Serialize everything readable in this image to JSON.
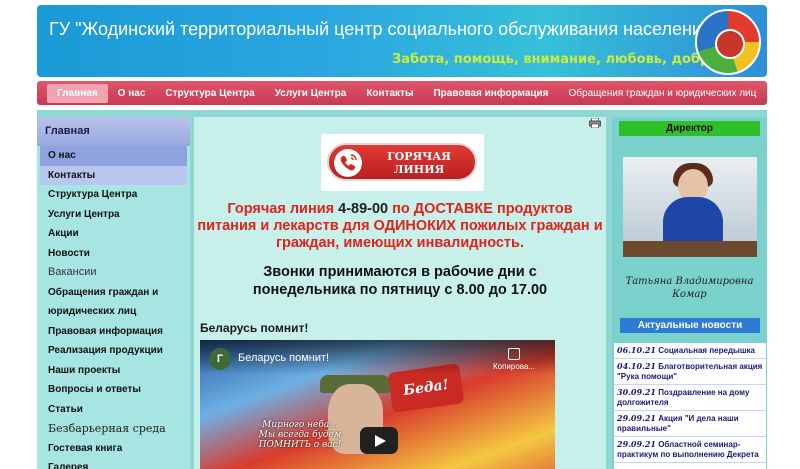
{
  "header": {
    "title": "ГУ \"Жодинский территориальный центр социального обслуживания населения\"",
    "slogan": "Забота, помощь, внимание, любовь, добро"
  },
  "topnav": {
    "items": [
      "Главная",
      "О нас",
      "Структура Центра",
      "Услуги Центра",
      "Контакты",
      "Правовая информация",
      "Обращения граждан и юридических лиц"
    ]
  },
  "sidebar": {
    "heading": "Главная",
    "items": [
      "О нас",
      "Контакты",
      "Структура Центра",
      "Услуги Центра",
      "Акции",
      "Новости",
      "Вакансии",
      "Обращения граждан и",
      "юридических лиц",
      "Правовая информация",
      "Реализация продукции",
      "Наши проекты",
      "Вопросы и ответы",
      "Статьи",
      "Безбарьерная среда",
      "Гостевая книга",
      "Галерея"
    ]
  },
  "center": {
    "hotline_banner": "ГОРЯЧАЯ ЛИНИЯ",
    "hotline_label": "Горячая линия",
    "hotline_number": "4-89-00",
    "hotline_rest": "по ДОСТАВКЕ продуктов питания и лекарств для ОДИНОКИХ пожилых граждан и граждан, имеющих инвалидность.",
    "calls_line1": "Звонки принимаются в рабочие дни с",
    "calls_line2": "понедельника по пятницу с 8.00 до 17.00",
    "section_title": "Беларусь помнит!",
    "video": {
      "channel_initial": "Г",
      "title": "Беларусь помнит!",
      "copy_label": "Копирова...",
      "caption": "Мирного неба... Мы всегда будем ПОМНИТЬ о вас!",
      "sign_text": "Беда!"
    }
  },
  "right": {
    "director_heading": "Директор",
    "director_name": "Татьяна Владимировна Комар",
    "news_heading": "Актуальные новости",
    "news": [
      {
        "date": "06.10.21",
        "title": "Социальная передышка"
      },
      {
        "date": "04.10.21",
        "title": "Благотворительная акция \"Рука помощи\""
      },
      {
        "date": "30.09.21",
        "title": "Поздравление на дому долгожителя"
      },
      {
        "date": "29.09.21",
        "title": "Акция \"И дела наши правильные\""
      },
      {
        "date": "29.09.21",
        "title": "Областной семинар-практикум по выполнению Декрета"
      }
    ]
  },
  "colors": {
    "header_blue": "#1a9ad6",
    "nav_red": "#c63a52",
    "hotline_red": "#e0221a",
    "director_green": "#2fbf29",
    "news_blue": "#2e7bd3"
  }
}
